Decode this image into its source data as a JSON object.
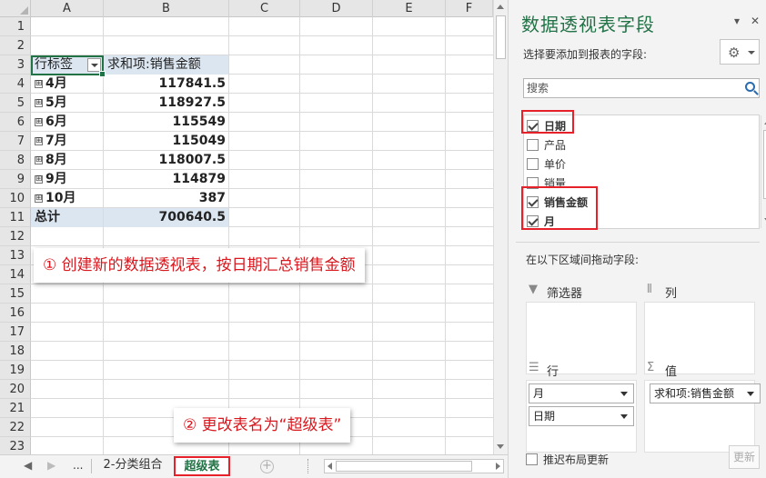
{
  "sheet": {
    "columns": [
      "A",
      "B",
      "C",
      "D",
      "E",
      "F"
    ],
    "rows": [
      "1",
      "2",
      "3",
      "4",
      "5",
      "6",
      "7",
      "8",
      "9",
      "10",
      "11",
      "12",
      "13",
      "14",
      "15",
      "16",
      "17",
      "18",
      "19",
      "20",
      "21",
      "22",
      "23"
    ],
    "pivot": {
      "row_label_header": "行标签",
      "value_header": "求和项:销售金额",
      "expander_symbol": "⊞",
      "rows": [
        {
          "label": "4月",
          "value": "117841.5"
        },
        {
          "label": "5月",
          "value": "118927.5"
        },
        {
          "label": "6月",
          "value": "115549"
        },
        {
          "label": "7月",
          "value": "115049"
        },
        {
          "label": "8月",
          "value": "118007.5"
        },
        {
          "label": "9月",
          "value": "114879"
        },
        {
          "label": "10月",
          "value": "387"
        }
      ],
      "total_label": "总计",
      "total_value": "700640.5"
    },
    "callout1": "① 创建新的数据透视表，按日期汇总销售金额",
    "callout2": "② 更改表名为“超级表”"
  },
  "tabs": {
    "ellipsis": "...",
    "items": [
      "2-分类组合",
      "超级表"
    ],
    "active": "超级表",
    "add_symbol": "+"
  },
  "pane": {
    "title": "数据透视表字段",
    "dropdown_symbol": "▾",
    "close_symbol": "✕",
    "subtitle": "选择要添加到报表的字段:",
    "search_placeholder": "搜索",
    "fields": [
      {
        "name": "日期",
        "checked": true
      },
      {
        "name": "产品",
        "checked": false
      },
      {
        "name": "单价",
        "checked": false
      },
      {
        "name": "销量",
        "checked": false
      },
      {
        "name": "销售金额",
        "checked": true
      },
      {
        "name": "月",
        "checked": true
      }
    ],
    "drag_hint": "在以下区域间拖动字段:",
    "areas": {
      "filters": "筛选器",
      "columns": "列",
      "rows": "行",
      "values": "值",
      "row_items": [
        "月",
        "日期"
      ],
      "value_items": [
        "求和项:销售金额"
      ]
    },
    "defer_label": "推迟布局更新",
    "update_label": "更新"
  },
  "colors": {
    "accent": "#217346",
    "highlight_red": "#e8202a",
    "pivot_header_bg": "#dce6f1"
  }
}
